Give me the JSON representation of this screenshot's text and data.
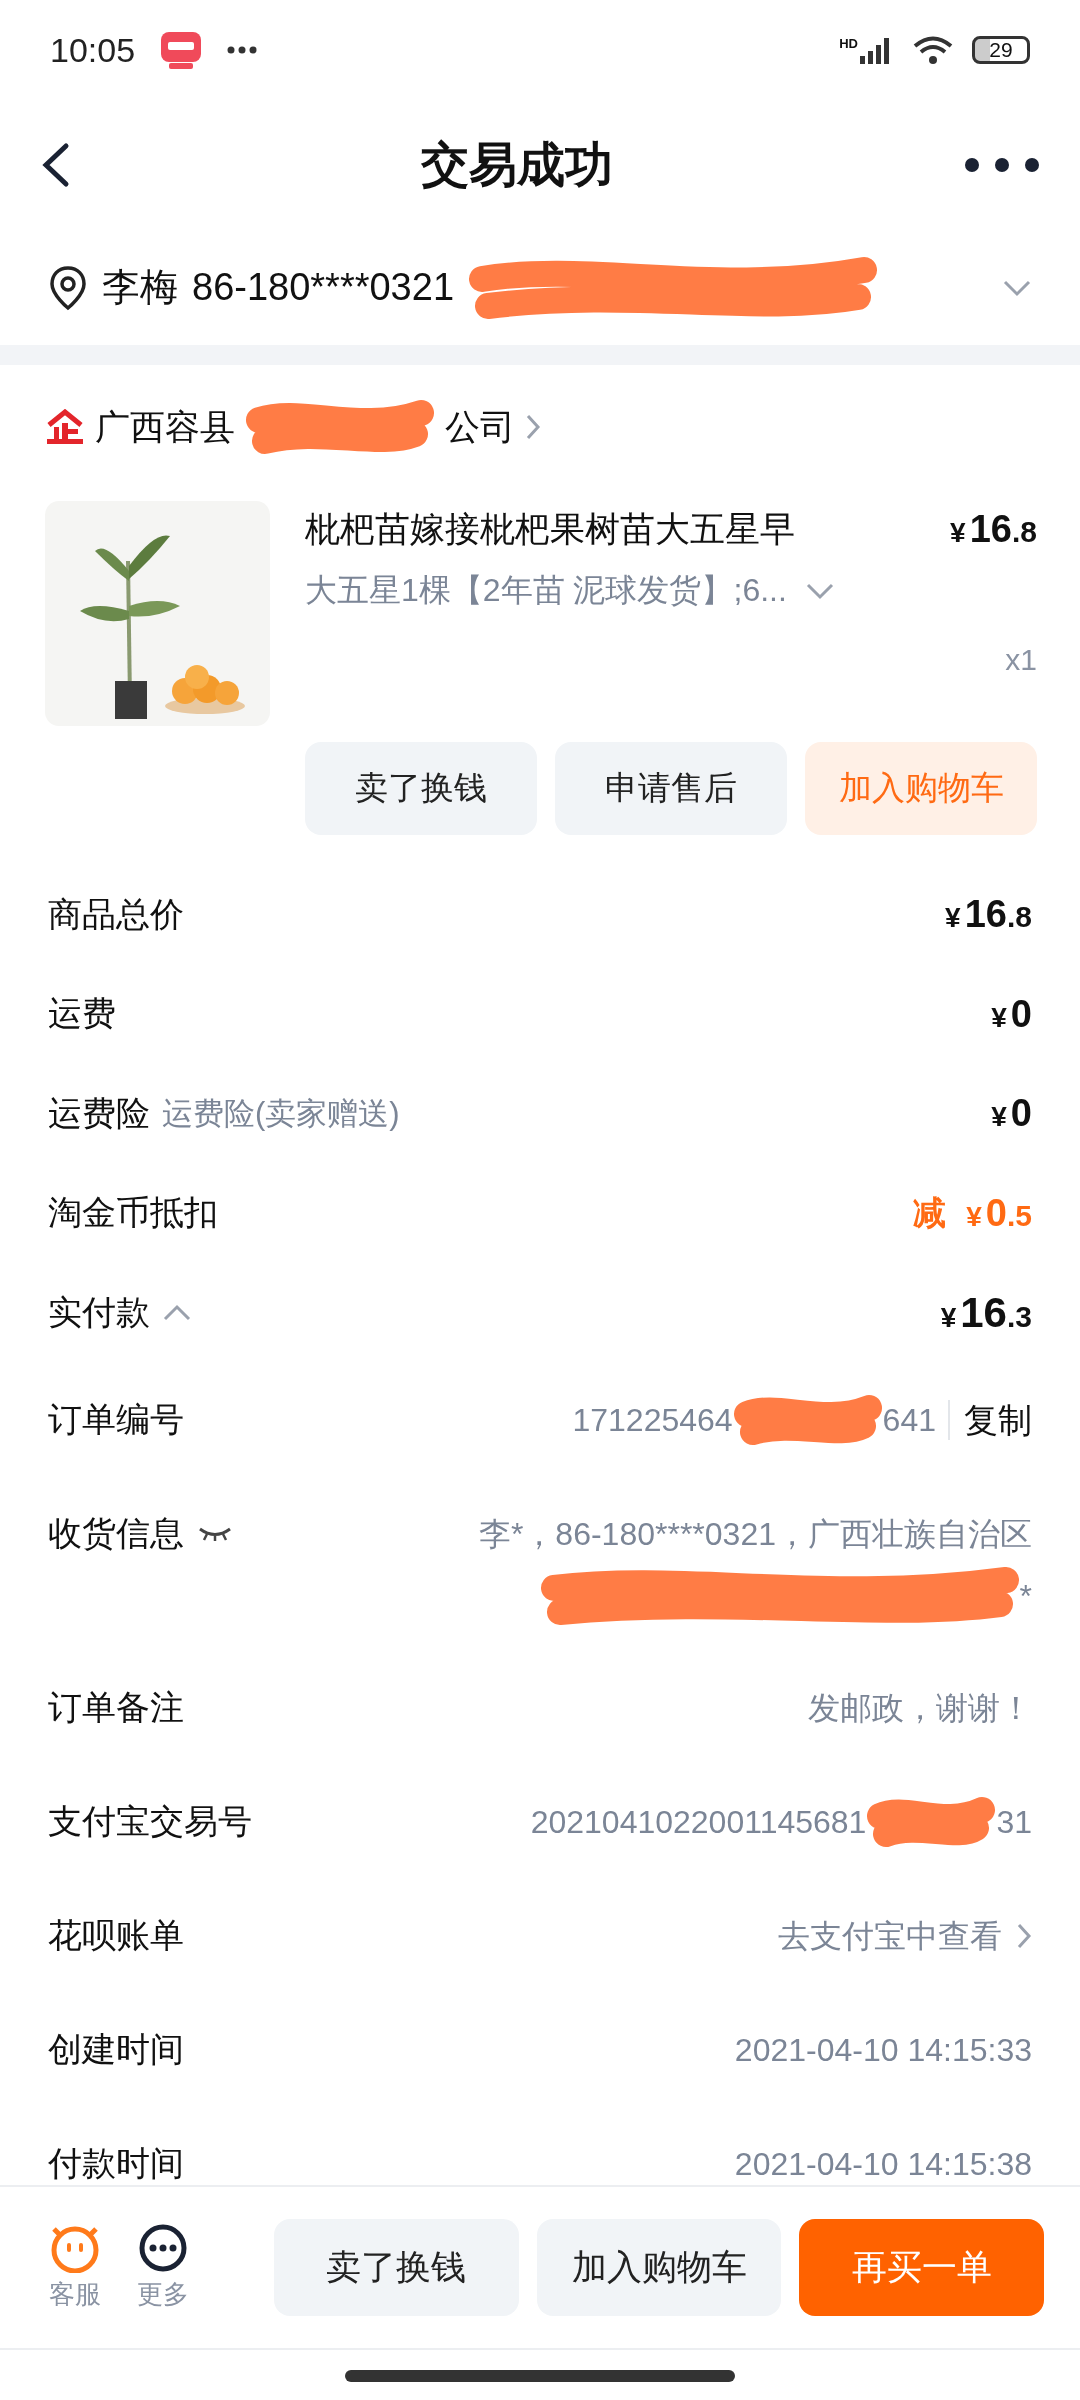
{
  "status_bar": {
    "time": "10:05",
    "network": "HD",
    "battery": "29"
  },
  "header": {
    "title": "交易成功"
  },
  "address": {
    "name": "李梅",
    "phone": "86-180****0321"
  },
  "store": {
    "name_start": "广西容县",
    "name_end": "公司"
  },
  "product": {
    "title": "枇杷苗嫁接枇杷果树苗大五星早",
    "sku": "大五星1棵【2年苗 泥球发货】;6...",
    "price": {
      "currency": "¥",
      "integer": "16",
      "decimal": ".8"
    },
    "quantity": "x1",
    "buttons": [
      {
        "label": "卖了换钱",
        "kind": "plain"
      },
      {
        "label": "申请售后",
        "kind": "plain"
      },
      {
        "label": "加入购物车",
        "kind": "accent"
      }
    ]
  },
  "price_rows": [
    {
      "label": "商品总价",
      "kind": "normal",
      "value": {
        "currency": "¥",
        "integer": "16",
        "decimal": ".8"
      }
    },
    {
      "label": "运费",
      "kind": "normal",
      "value": {
        "currency": "¥",
        "integer": "0"
      }
    },
    {
      "label": "运费险",
      "note": "运费险(卖家赠送)",
      "kind": "normal",
      "value": {
        "currency": "¥",
        "integer": "0"
      }
    },
    {
      "label": "淘金币抵扣",
      "kind": "discount",
      "prefix": "减",
      "value": {
        "currency": "¥",
        "integer": "0",
        "decimal": ".5"
      }
    },
    {
      "label": "实付款",
      "kind": "total",
      "expanded": true,
      "value": {
        "currency": "¥",
        "integer": "16",
        "decimal": ".3"
      }
    }
  ],
  "order_info": [
    {
      "kind": "redacted",
      "label": "订单编号",
      "value_start": "171225464",
      "value_end": "641",
      "action": "复制"
    },
    {
      "kind": "shipping",
      "label": "收货信息",
      "hidden": true,
      "line1": "李*，86-180****0321，广西壮族自治区",
      "line2_end": "*"
    },
    {
      "kind": "text",
      "label": "订单备注",
      "value": "发邮政，谢谢！"
    },
    {
      "kind": "redacted",
      "label": "支付宝交易号",
      "value_start": "2021041022001145681",
      "value_end": "31"
    },
    {
      "kind": "link",
      "label": "花呗账单",
      "value": "去支付宝中查看"
    },
    {
      "kind": "text",
      "label": "创建时间",
      "value": "2021-04-10 14:15:33"
    },
    {
      "kind": "text",
      "label": "付款时间",
      "value": "2021-04-10 14:15:38"
    }
  ],
  "bottom_bar": {
    "shortcuts": [
      {
        "label": "客服",
        "kind": "service"
      },
      {
        "label": "更多",
        "kind": "more"
      }
    ],
    "buttons": [
      {
        "label": "卖了换钱",
        "kind": "plain"
      },
      {
        "label": "加入购物车",
        "kind": "plain"
      },
      {
        "label": "再买一单",
        "kind": "primary"
      }
    ]
  }
}
